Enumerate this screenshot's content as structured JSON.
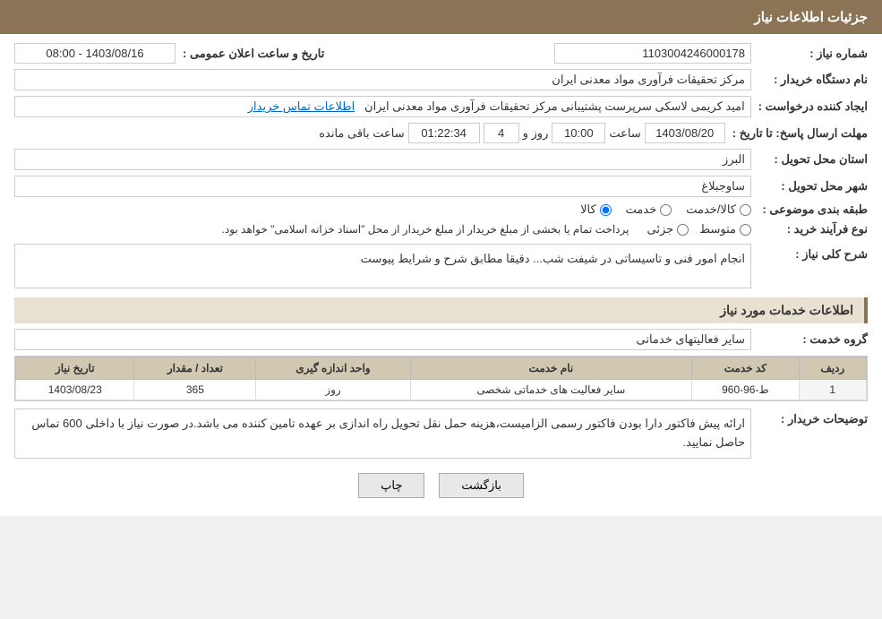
{
  "header": {
    "title": "جزئیات اطلاعات نیاز"
  },
  "fields": {
    "shomara_niyaz_label": "شماره نیاز :",
    "shomara_niyaz_value": "1103004246000178",
    "nam_dastgah_label": "نام دستگاه خریدار :",
    "nam_dastgah_value": "مرکز تحقیقات فرآوری مواد معدنی ایران",
    "ejad_konande_label": "ایجاد کننده درخواست :",
    "ejad_konande_value": "امید کریمی لاسکی سرپرست پشتیبانی مرکز تحقیقات فرآوری مواد معدنی ایران",
    "ejad_konande_link": "اطلاعات تماس خریدار",
    "mohlat_label": "مهلت ارسال پاسخ: تا تاریخ :",
    "mohlat_date": "1403/08/20",
    "mohlat_saat_label": "ساعت",
    "mohlat_saat": "10:00",
    "mohlat_roz_label": "روز و",
    "mohlat_roz": "4",
    "mohlat_baqi": "01:22:34",
    "mohlat_baqi_label": "ساعت باقی مانده",
    "ostan_label": "استان محل تحویل :",
    "ostan_value": "البرز",
    "shahr_label": "شهر محل تحویل :",
    "shahr_value": "ساوجبلاغ",
    "tabaqe_label": "طبقه بندی موضوعی :",
    "tabaqe_options": [
      {
        "label": "کالا",
        "selected": true
      },
      {
        "label": "خدمت",
        "selected": false
      },
      {
        "label": "کالا/خدمت",
        "selected": false
      }
    ],
    "nofarayand_label": "نوع فرآیند خرید :",
    "nofarayand_options": [
      {
        "label": "جزئی",
        "selected": false
      },
      {
        "label": "متوسط",
        "selected": false
      }
    ],
    "nofarayand_note": "پرداخت تمام یا بخشی از مبلغ خریدار از مبلغ خریدار از محل \"اسناد خزانه اسلامی\" خواهد بود.",
    "sharh_label": "شرح کلی نیاز :",
    "sharh_value": "انجام امور فنی و تاسیساتی در شیفت شب... دقیقا مطابق شرح و شرایط پیوست",
    "khadamat_section_label": "اطلاعات خدمات مورد نیاز",
    "goroh_label": "گروه خدمت :",
    "goroh_value": "سایر فعالیتهای خدماتی",
    "table": {
      "headers": [
        "ردیف",
        "کد خدمت",
        "نام خدمت",
        "واحد اندازه گیری",
        "تعداد / مقدار",
        "تاریخ نیاز"
      ],
      "rows": [
        {
          "radif": "1",
          "kod": "ط-96-960",
          "nam": "سایر فعالیت های خدماتی شخصی",
          "vahed": "روز",
          "tedad": "365",
          "tarikh": "1403/08/23"
        }
      ]
    },
    "tosif_label": "توضیحات خریدار :",
    "tosif_value": "ارائه  پیش فاکتور دارا بودن فاکتور رسمی الزامیست،هزینه حمل نقل تحویل راه اندازی بر عهده تامین کننده می باشد.در صورت نیاز با داخلی 600 تماس حاصل نمایید.",
    "tarikhosaat_label": "تاریخ و ساعت اعلان عمومی :",
    "tarikhosaat_value": "1403/08/16 - 08:00"
  },
  "buttons": {
    "print": "چاپ",
    "back": "بازگشت"
  }
}
